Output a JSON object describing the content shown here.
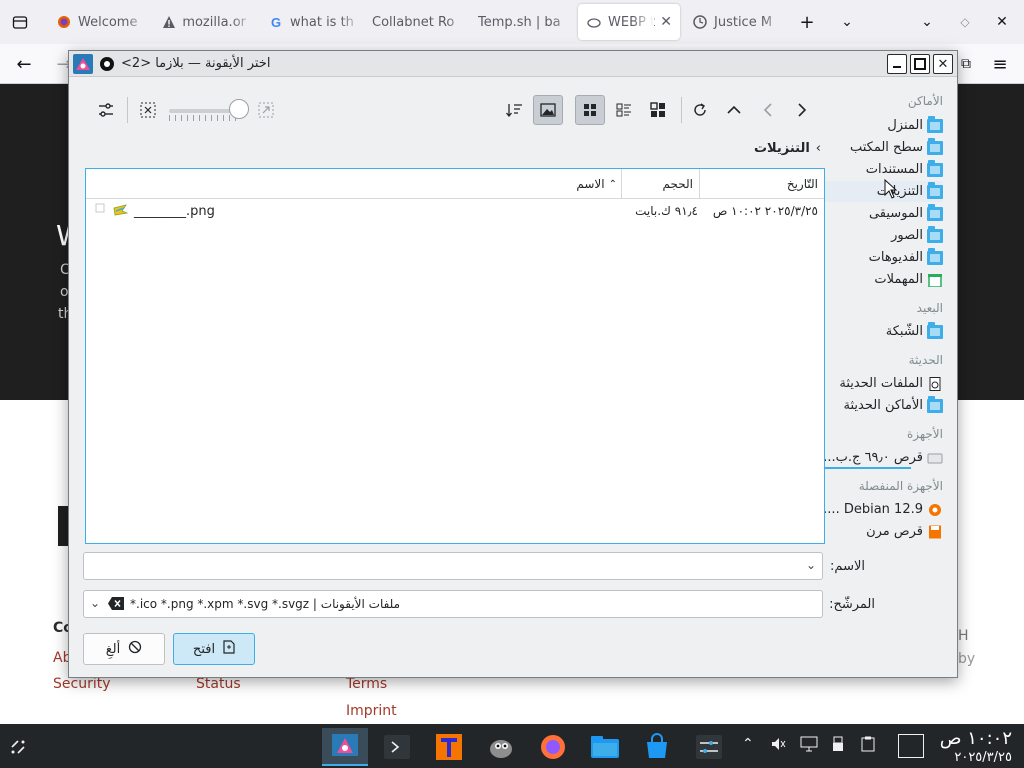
{
  "browser": {
    "tabs": [
      {
        "title": "Welcome",
        "icon": "firefox-icon"
      },
      {
        "title": "mozilla.or",
        "icon": "warning-icon"
      },
      {
        "title": "what is th",
        "icon": "google-icon"
      },
      {
        "title": "Collabnet Ro",
        "icon": "blank-icon"
      },
      {
        "title": "Temp.sh | ba",
        "icon": "blank-icon"
      },
      {
        "title": "WEBP t",
        "icon": "image-icon"
      },
      {
        "title": "Justice M",
        "icon": "clock-icon"
      }
    ],
    "colors": {
      "tabbar": "#f0f0f4",
      "navbar": "#f9f9fb"
    }
  },
  "webpage": {
    "hero_fragments": [
      "C",
      "o",
      "th",
      "W"
    ],
    "footer": {
      "fragments": [
        "Co",
        "Ab",
        "H",
        "by"
      ],
      "links": [
        "Security",
        "Status",
        "Terms",
        "Imprint"
      ]
    }
  },
  "dialog": {
    "title": "اختر الأيقونة — بلازما <2>",
    "breadcrumb": "التنزيلات",
    "places": {
      "sections": [
        {
          "header": "الأماكن",
          "items": [
            "المنزل",
            "سطح المكتب",
            "المستندات",
            "التنزيلات",
            "الموسيقى",
            "الصور",
            "الفديوهات",
            "المهملات"
          ]
        },
        {
          "header": "البعيد",
          "items": [
            "الشّبكة"
          ]
        },
        {
          "header": "الحديثة",
          "items": [
            "الملفات الحديثة",
            "الأماكن الحديثة"
          ]
        },
        {
          "header": "الأجهزة",
          "items": [
            "قرص ٦٩٫٠ ج.ب..."
          ]
        },
        {
          "header": "الأجهزة المنفصلة",
          "items": [
            "Debian 12.9 ....",
            "قرص مرن"
          ]
        }
      ]
    },
    "columns": {
      "name": "الاسم",
      "size": "الحجم",
      "date": "التّاريخ"
    },
    "files": [
      {
        "name": "________.png",
        "size": "٩١٫٤ ك.بايت",
        "date": "٢٠٢٥/٣/٢٥ ١٠:٠٢ ص"
      }
    ],
    "name_label": "الاسم:",
    "name_value": "",
    "filter_label": "المرشّح:",
    "filter_value": "*.ico *.png *.xpm *.svg *.svgz | ملفات الأيقونات",
    "open_button": "افتح",
    "cancel_button": "ألغِ",
    "accent": "#3daee9"
  },
  "taskbar": {
    "clock_time": "١٠:٠٢ ص",
    "clock_date": "٢٠٢٥/٣/٢٥",
    "colors": {
      "background": "#232629",
      "accent": "#3daee9"
    }
  }
}
